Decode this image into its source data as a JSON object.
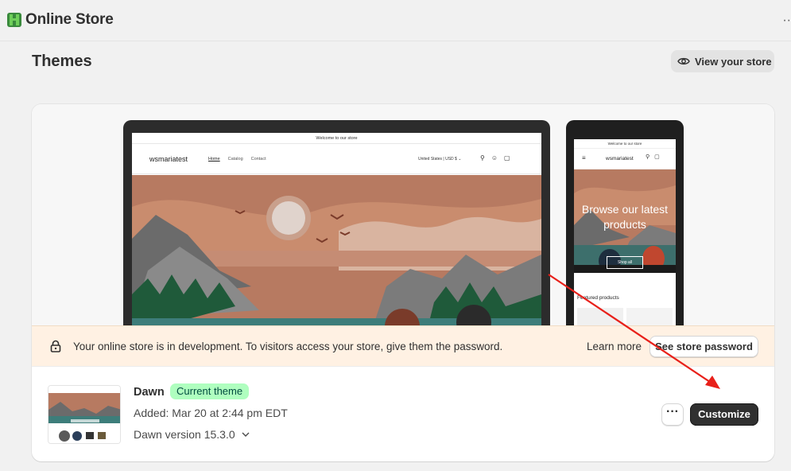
{
  "app": {
    "title": "Online Store",
    "more": "··"
  },
  "page": {
    "title": "Themes",
    "view_store_label": "View your store"
  },
  "preview": {
    "desktop": {
      "announcement": "Welcome to our store",
      "store_name": "wsmariatest",
      "nav": [
        "Home",
        "Catalog",
        "Contact"
      ],
      "region": "United States | USD $"
    },
    "mobile": {
      "announcement": "Welcome to our store",
      "store_name": "wsmariatest",
      "hero_text": "Browse our latest products",
      "shop_all": "Shop all",
      "featured_title": "Featured products"
    }
  },
  "banner": {
    "message": "Your online store is in development. To visitors access your store, give them the password.",
    "learn_more": "Learn more",
    "password_button": "See store password"
  },
  "theme": {
    "name": "Dawn",
    "badge": "Current theme",
    "added": "Added: Mar 20 at 2:44 pm EDT",
    "version": "Dawn version 15.3.0",
    "more_label": "···",
    "customize_label": "Customize"
  },
  "colors": {
    "primary_button": "#303030",
    "badge_bg": "#affebf",
    "banner_bg": "#fff1e3",
    "annotation_arrow": "#e8201a"
  }
}
